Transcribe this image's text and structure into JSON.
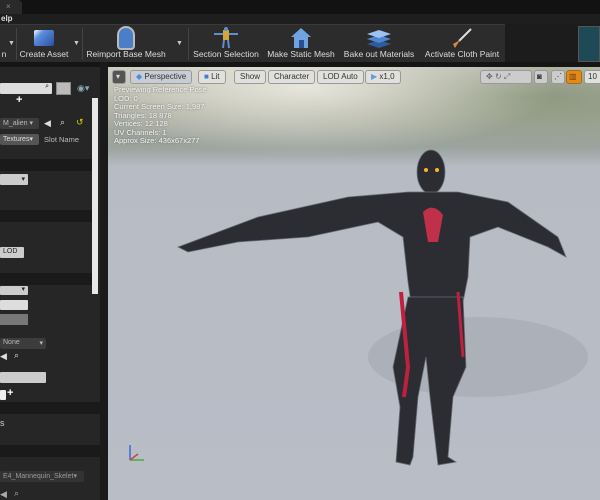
{
  "tab": {
    "close": "×"
  },
  "menu": {
    "help": "elp"
  },
  "toolbar": {
    "items": [
      {
        "label": "n",
        "icon": "save-icon"
      },
      {
        "label": "Create Asset",
        "icon": "create-asset-icon"
      },
      {
        "label": "Reimport Base Mesh",
        "icon": "reimport-icon"
      },
      {
        "label": "Section Selection",
        "icon": "section-selection-icon"
      },
      {
        "label": "Make Static Mesh",
        "icon": "house-icon"
      },
      {
        "label": "Bake out Materials",
        "icon": "layers-icon"
      },
      {
        "label": "Activate Cloth Paint",
        "icon": "brush-icon"
      }
    ]
  },
  "left_panel": {
    "material": "M_alien",
    "textures": "Textures",
    "slot_name": "Slot Name",
    "lod_button": "LOD",
    "none_value": "None",
    "skeleton": "E4_Mannequin_Skelet",
    "section_text": "s"
  },
  "viewport": {
    "toolbar": {
      "perspective": "Perspective",
      "lit": "Lit",
      "show": "Show",
      "character": "Character",
      "lod": "LOD Auto",
      "speed": "x1,0",
      "grid": "10"
    },
    "stats": [
      "Previewing Reference Pose",
      "LOD: 0",
      "Current Screen Size: 1,987",
      "Triangles: 18 878",
      "Vertices: 12 128",
      "UV Channels: 1",
      "Approx Size: 436x67x277"
    ]
  },
  "colors": {
    "accent_orange": "#e08a1e",
    "viewport_bg": "#b9bdc6"
  }
}
